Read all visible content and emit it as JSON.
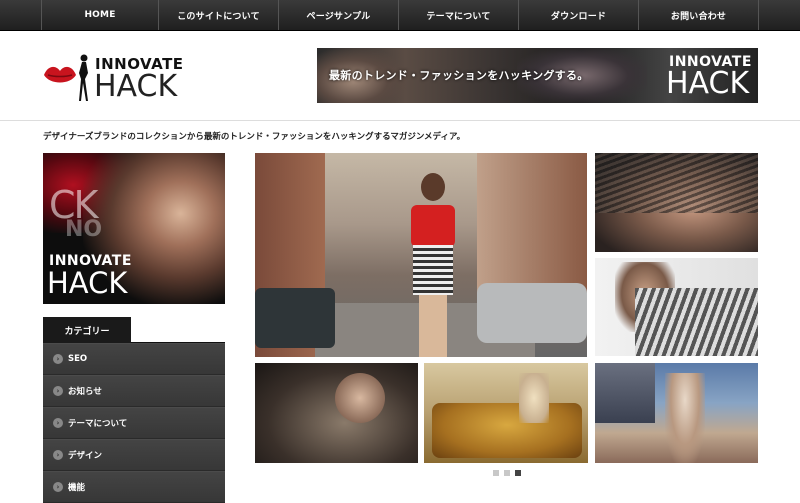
{
  "nav": {
    "items": [
      "HOME",
      "このサイトについて",
      "ページサンプル",
      "テーマについて",
      "ダウンロード",
      "お問い合わせ"
    ]
  },
  "logo": {
    "top": "INNOVATE",
    "bottom": "HACK"
  },
  "banner": {
    "text": "最新のトレンド・ファッションをハッキングする。",
    "top": "INNOVATE",
    "bottom": "HACK"
  },
  "tagline": "デザイナーズブランドのコレクションから最新のトレンド・ファッションをハッキングするマガジンメディア。",
  "sidebar_image": {
    "ck": "CK",
    "no": "NO",
    "top": "INNOVATE",
    "bottom": "HACK"
  },
  "categories": {
    "title": "カテゴリー",
    "items": [
      "SEO",
      "お知らせ",
      "テーマについて",
      "デザイン",
      "機能"
    ]
  },
  "slider": {
    "pages": 3,
    "active": 3
  },
  "colors": {
    "nav_bg": "#2a2a2a",
    "accent_red": "#d42020",
    "sidebar_bg": "#3c3c3c"
  }
}
